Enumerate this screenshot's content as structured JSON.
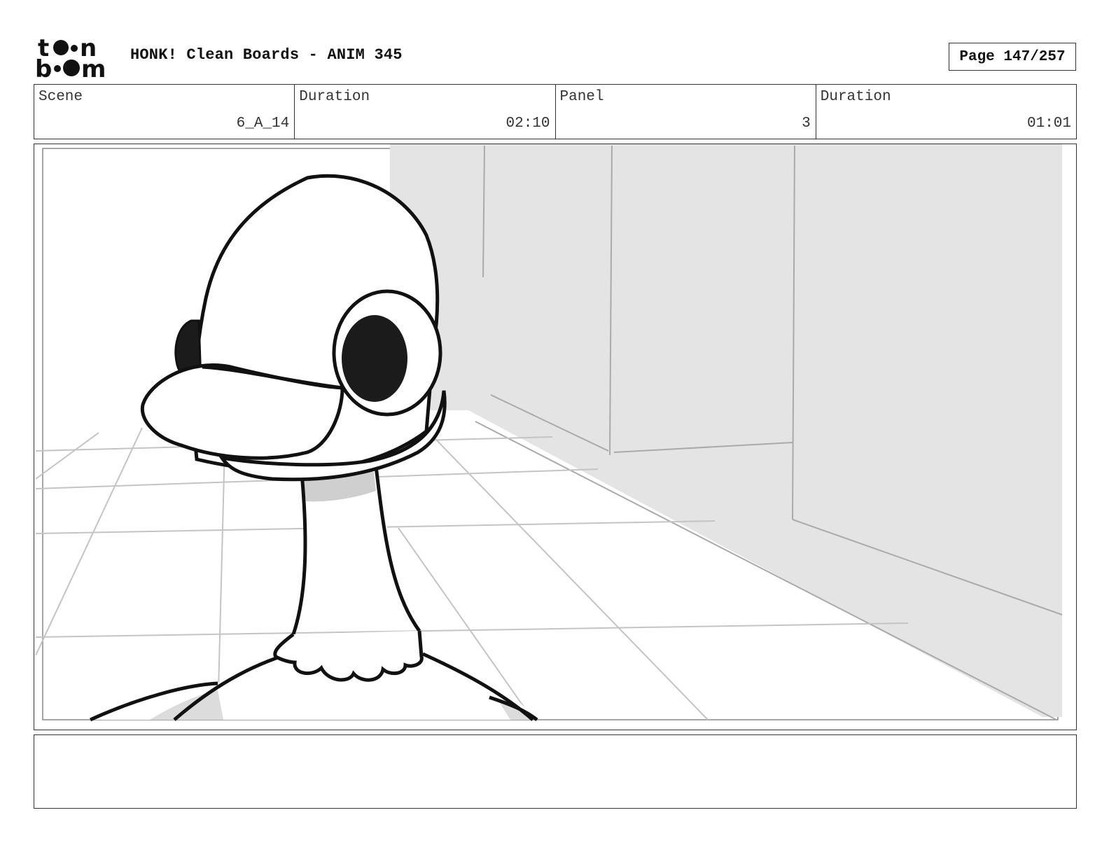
{
  "header": {
    "logo_text": "toon boom",
    "title": "HONK! Clean Boards - ANIM 345",
    "page_label": "Page 147/257"
  },
  "info": [
    {
      "label": "Scene",
      "value": "6_A_14"
    },
    {
      "label": "Duration",
      "value": "02:10"
    },
    {
      "label": "Panel",
      "value": "3"
    },
    {
      "label": "Duration",
      "value": "01:01"
    }
  ],
  "panel": {
    "image_icon": "duck-character-drawing"
  },
  "notes": {
    "text": ""
  }
}
